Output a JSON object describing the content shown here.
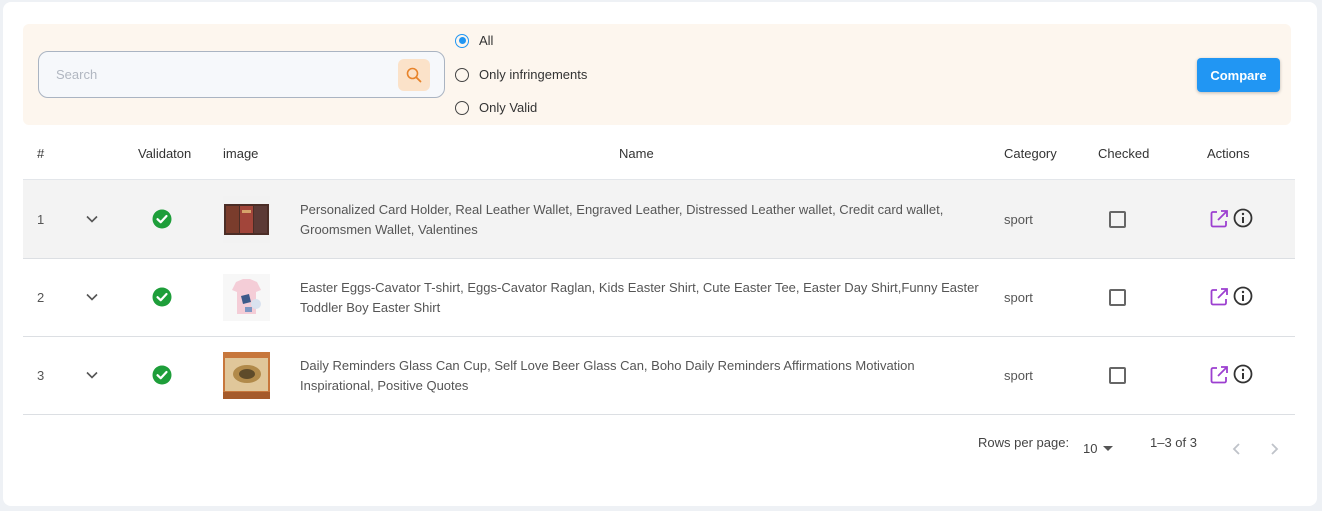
{
  "search": {
    "placeholder": "Search"
  },
  "filters": {
    "options": [
      {
        "label": "All",
        "selected": true
      },
      {
        "label": "Only infringements",
        "selected": false
      },
      {
        "label": "Only Valid",
        "selected": false
      }
    ]
  },
  "toolbar": {
    "compare_label": "Compare"
  },
  "table": {
    "headers": {
      "num": "#",
      "validation": "Validaton",
      "image": "image",
      "name": "Name",
      "category": "Category",
      "checked": "Checked",
      "actions": "Actions"
    },
    "rows": [
      {
        "index": "1",
        "name": "Personalized Card Holder, Real Leather Wallet, Engraved Leather, Distressed Leather wallet, Credit card wallet, Groomsmen Wallet, Valentines",
        "category": "sport",
        "valid": true,
        "checked": false
      },
      {
        "index": "2",
        "name": "Easter Eggs-Cavator T-shirt, Eggs-Cavator Raglan, Kids Easter Shirt, Cute Easter Tee, Easter Day Shirt,Funny Easter Toddler Boy Easter Shirt",
        "category": "sport",
        "valid": true,
        "checked": false
      },
      {
        "index": "3",
        "name": "Daily Reminders Glass Can Cup, Self Love Beer Glass Can, Boho Daily Reminders Affirmations Motivation Inspirational, Positive Quotes",
        "category": "sport",
        "valid": true,
        "checked": false
      }
    ]
  },
  "pagination": {
    "rows_per_page_label": "Rows per page:",
    "rows_per_page_value": "10",
    "range_text": "1–3 of 3"
  },
  "colors": {
    "accent": "#2196f3",
    "valid_green": "#1e9e3a",
    "action_purple": "#9c3fd0",
    "filter_bg": "#fdf6ee",
    "search_button_bg": "#fbe2c9"
  }
}
